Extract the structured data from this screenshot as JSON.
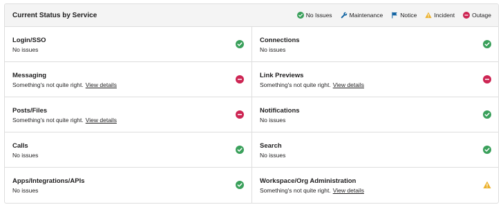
{
  "header": {
    "title": "Current Status by Service",
    "legend": [
      {
        "icon": "check-circle-icon",
        "label": "No Issues",
        "color": "#3aa05b"
      },
      {
        "icon": "wrench-icon",
        "label": "Maintenance",
        "color": "#1264a3"
      },
      {
        "icon": "flag-icon",
        "label": "Notice",
        "color": "#1264a3"
      },
      {
        "icon": "warning-triangle-icon",
        "label": "Incident",
        "color": "#ecb22e"
      },
      {
        "icon": "minus-circle-icon",
        "label": "Outage",
        "color": "#cd2553"
      }
    ]
  },
  "services": [
    {
      "name": "Login/SSO",
      "status": "No issues",
      "state": "ok"
    },
    {
      "name": "Connections",
      "status": "No issues",
      "state": "ok"
    },
    {
      "name": "Messaging",
      "status": "Something's not quite right.",
      "link": "View details",
      "state": "outage"
    },
    {
      "name": "Link Previews",
      "status": "Something's not quite right.",
      "link": "View details",
      "state": "outage"
    },
    {
      "name": "Posts/Files",
      "status": "Something's not quite right.",
      "link": "View details",
      "state": "outage"
    },
    {
      "name": "Notifications",
      "status": "No issues",
      "state": "ok"
    },
    {
      "name": "Calls",
      "status": "No issues",
      "state": "ok"
    },
    {
      "name": "Search",
      "status": "No issues",
      "state": "ok"
    },
    {
      "name": "Apps/Integrations/APIs",
      "status": "No issues",
      "state": "ok"
    },
    {
      "name": "Workspace/Org Administration",
      "status": "Something's not quite right.",
      "link": "View details",
      "state": "incident"
    }
  ],
  "colors": {
    "ok": "#3aa05b",
    "outage": "#cd2553",
    "incident": "#ecb22e",
    "maintenance": "#1264a3"
  }
}
